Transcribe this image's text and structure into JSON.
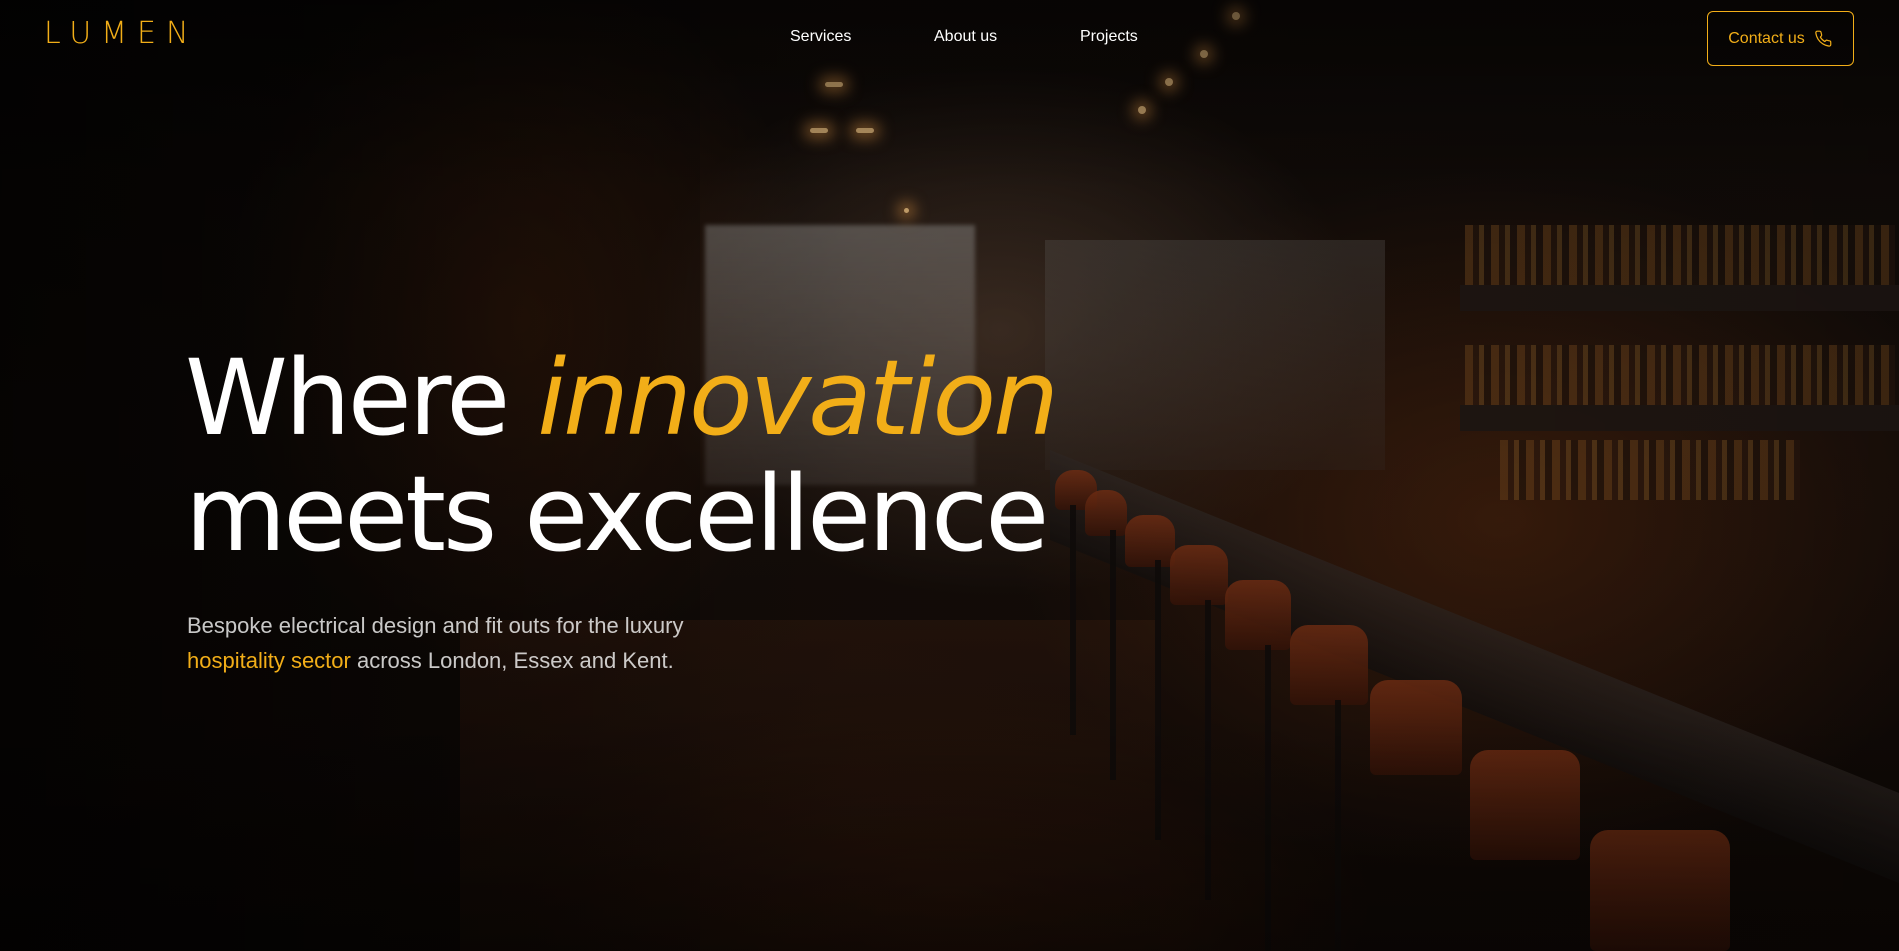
{
  "brand": {
    "logo_text": "LUMEN",
    "accent_color": "#f2ae18"
  },
  "nav": {
    "items": [
      {
        "label": "Services"
      },
      {
        "label": "About us"
      },
      {
        "label": "Projects"
      }
    ]
  },
  "contact": {
    "label": "Contact us",
    "icon": "phone-icon"
  },
  "hero": {
    "headline_line1_pre": "Where ",
    "headline_line1_accent": "innovation",
    "headline_line2": "meets excellence",
    "sub_line1": "Bespoke electrical design and fit outs for the luxury",
    "sub_accent": "hospitality sector",
    "sub_rest": " across London, Essex and Kent.",
    "background_image": "restaurant-bar-interior"
  }
}
